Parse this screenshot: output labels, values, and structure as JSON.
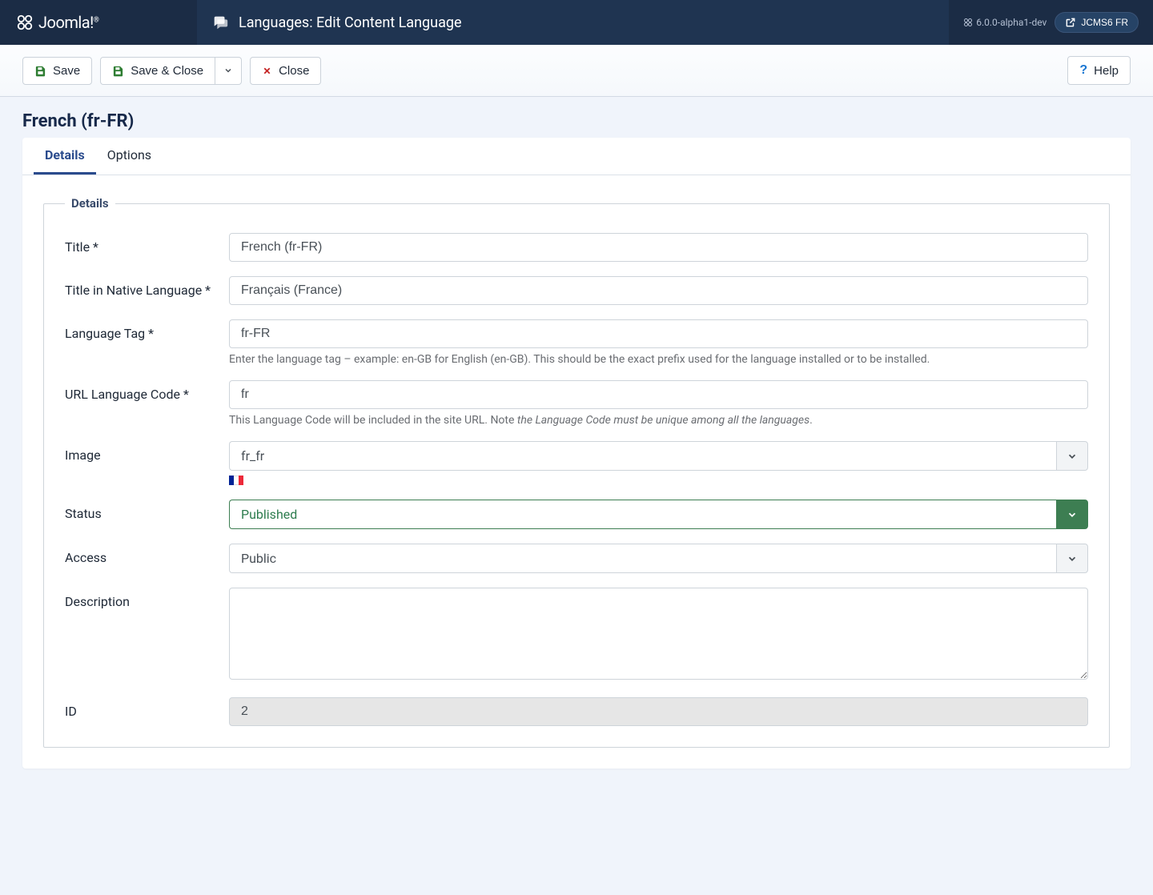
{
  "brand": "Joomla!",
  "header": {
    "title": "Languages: Edit Content Language",
    "version": "6.0.0-alpha1-dev",
    "site_button": "JCMS6 FR"
  },
  "toolbar": {
    "save": "Save",
    "save_close": "Save & Close",
    "close": "Close",
    "help": "Help"
  },
  "page_title": "French (fr-FR)",
  "tabs": {
    "details": "Details",
    "options": "Options"
  },
  "fieldset_legend": "Details",
  "fields": {
    "title": {
      "label": "Title *",
      "value": "French (fr-FR)"
    },
    "native": {
      "label": "Title in Native Language *",
      "value": "Français (France)"
    },
    "langtag": {
      "label": "Language Tag *",
      "value": "fr-FR",
      "help": "Enter the language tag – example: en-GB for English (en-GB). This should be the exact prefix used for the language installed or to be installed."
    },
    "urlcode": {
      "label": "URL Language Code *",
      "value": "fr",
      "help_pre": "This Language Code will be included in the site URL. Note ",
      "help_em": "the Language Code must be unique among all the languages",
      "help_post": "."
    },
    "image": {
      "label": "Image",
      "value": "fr_fr"
    },
    "status": {
      "label": "Status",
      "value": "Published"
    },
    "access": {
      "label": "Access",
      "value": "Public"
    },
    "description": {
      "label": "Description",
      "value": ""
    },
    "id": {
      "label": "ID",
      "value": "2"
    }
  }
}
